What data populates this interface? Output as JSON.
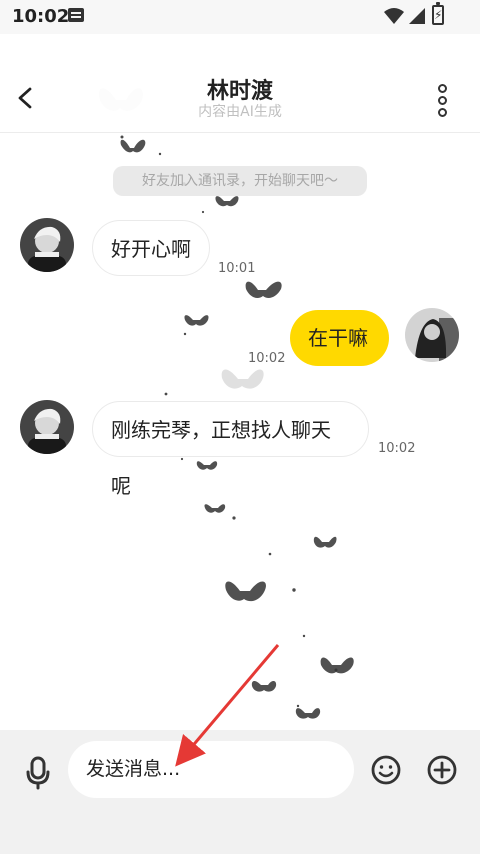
{
  "status": {
    "time": "10:02"
  },
  "header": {
    "title": "林时渡",
    "subtitle": "内容由AI生成"
  },
  "notice": "好友加入通讯录，开始聊天吧～",
  "messages": [
    {
      "text": "好开心啊",
      "time": "10:01"
    },
    {
      "text": "在干嘛",
      "time": "10:02"
    },
    {
      "text": "刚练完琴，正想找人聊天呢",
      "time": "10:02"
    }
  ],
  "input": {
    "placeholder": "发送消息..."
  },
  "icons": {
    "back": "back-arrow-icon",
    "more": "more-vertical-icon",
    "microphone": "microphone-icon",
    "emoji": "emoji-icon",
    "add": "plus-circle-icon"
  },
  "colors": {
    "outgoing_bubble": "#ffd900",
    "annotation_arrow": "#e53935"
  }
}
